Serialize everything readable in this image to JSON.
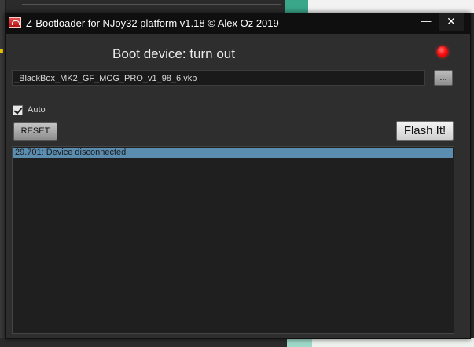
{
  "window": {
    "title": "Z-Bootloader for NJoy32 platform v1.18 © Alex Oz 2019",
    "minimize_label": "—",
    "close_label": "✕"
  },
  "status": {
    "text": "Boot device: turn out",
    "indicator_color": "#ff1010"
  },
  "file": {
    "value": "_BlackBox_MK2_GF_MCG_PRO_v1_98_6.vkb",
    "browse_label": "..."
  },
  "options": {
    "auto_label": "Auto",
    "auto_checked": true
  },
  "buttons": {
    "reset_label": "RESET",
    "flash_label": "Flash It!"
  },
  "log": {
    "entries": [
      "29.701: Device disconnected"
    ]
  }
}
